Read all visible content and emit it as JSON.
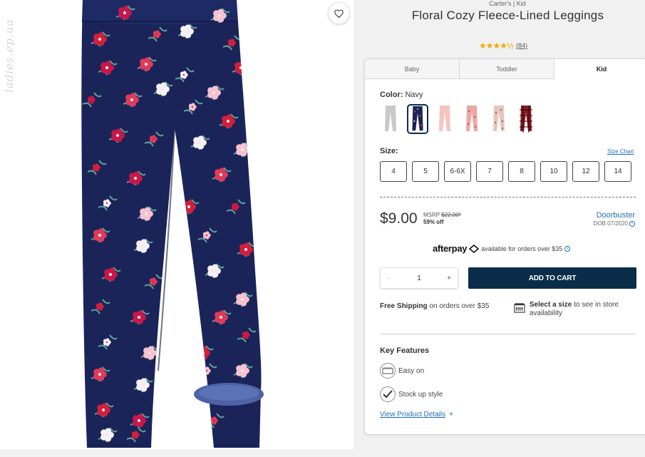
{
  "watermark": "ladies.ep.ua",
  "product": {
    "brand_line": "Carter's | Kid",
    "title": "Floral Cozy Fleece-Lined Leggings",
    "stars": "★★★★½",
    "review_count": "(84)"
  },
  "tabs": [
    {
      "label": "Baby",
      "active": false
    },
    {
      "label": "Toddler",
      "active": false
    },
    {
      "label": "Kid",
      "active": true
    }
  ],
  "color": {
    "label": "Color:",
    "selected": "Navy",
    "swatches": [
      {
        "name": "gray",
        "hex": "#c8c8c8"
      },
      {
        "name": "navy-floral",
        "hex": "#1b2357",
        "selected": true
      },
      {
        "name": "light-pink",
        "hex": "#f7c3c1"
      },
      {
        "name": "pink-floral",
        "hex": "#e9a9a5"
      },
      {
        "name": "pink-print",
        "hex": "#e8c2bd"
      },
      {
        "name": "red-plaid",
        "hex": "#8a1720"
      }
    ]
  },
  "size": {
    "label": "Size:",
    "chart_link": "Size Chart",
    "options": [
      "4",
      "5",
      "6-6X",
      "7",
      "8",
      "10",
      "12",
      "14"
    ]
  },
  "pricing": {
    "price": "$9.00",
    "msrp_label": "MSRP",
    "msrp_value": "$22.00*",
    "percent_off": "59% off",
    "doorbuster": "Doorbuster",
    "dob": "DOB 07/2020"
  },
  "afterpay": {
    "logo": "afterpay",
    "text": "available for orders over $35"
  },
  "cart": {
    "minus": "-",
    "quantity": "1",
    "plus": "+",
    "add_label": "ADD TO CART"
  },
  "shipping": {
    "bold": "Free Shipping",
    "rest": "on orders over $35"
  },
  "store": {
    "bold": "Select a size",
    "rest": "to see in store availability"
  },
  "features": {
    "title": "Key Features",
    "items": [
      "Easy on",
      "Stock up style"
    ],
    "details_link": "View Product Details",
    "details_plus": "+"
  },
  "colors": {
    "accent_navy": "#0b2d4a",
    "link_blue": "#1c6fb5",
    "star_gold": "#f2a900"
  }
}
